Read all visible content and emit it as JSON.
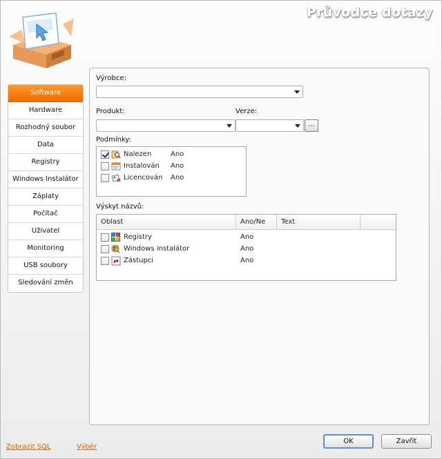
{
  "window": {
    "title": "Průvodce dotazy"
  },
  "nav": {
    "items": [
      {
        "label": "Software",
        "active": true
      },
      {
        "label": "Hardware"
      },
      {
        "label": "Rozhodný soubor"
      },
      {
        "label": "Data"
      },
      {
        "label": "Registry"
      },
      {
        "label": "Windows Instalátor"
      },
      {
        "label": "Záplaty"
      },
      {
        "label": "Počítač"
      },
      {
        "label": "Uživatel"
      },
      {
        "label": "Monitoring"
      },
      {
        "label": "USB soubory"
      },
      {
        "label": "Sledování změn"
      }
    ]
  },
  "form": {
    "vyrobce_label": "Výrobce:",
    "vyrobce_value": "",
    "produkt_label": "Produkt:",
    "produkt_value": "",
    "verze_label": "Verze:",
    "verze_value": "",
    "browse_label": "...",
    "podminky_label": "Podmínky:",
    "conditions": [
      {
        "name": "Nalezen",
        "value": "Ano",
        "checked": true,
        "icon": "search-found-icon"
      },
      {
        "name": "Instalován",
        "value": "Ano",
        "checked": false,
        "icon": "installed-window-icon"
      },
      {
        "name": "Licencován",
        "value": "Ano",
        "checked": false,
        "icon": "license-icon"
      }
    ],
    "vyskyt_label": "Výskyt názvů:",
    "grid": {
      "headers": [
        "Oblast",
        "Ano/Ne",
        "Text"
      ],
      "rows": [
        {
          "name": "Registry",
          "value": "Ano",
          "text": "",
          "checked": false,
          "icon": "registry-icon"
        },
        {
          "name": "Windows instalátor",
          "value": "Ano",
          "text": "",
          "checked": false,
          "icon": "windows-installer-icon"
        },
        {
          "name": "Zástupci",
          "value": "Ano",
          "text": "",
          "checked": false,
          "icon": "shortcut-icon"
        }
      ]
    }
  },
  "footer": {
    "show_sql": "Zobrazit SQL",
    "selection": "Výběr",
    "ok": "OK",
    "close": "Zavřít"
  },
  "colors": {
    "accent": "#f27a10",
    "link": "#e06000",
    "default_button_border": "#5b8fd0"
  }
}
